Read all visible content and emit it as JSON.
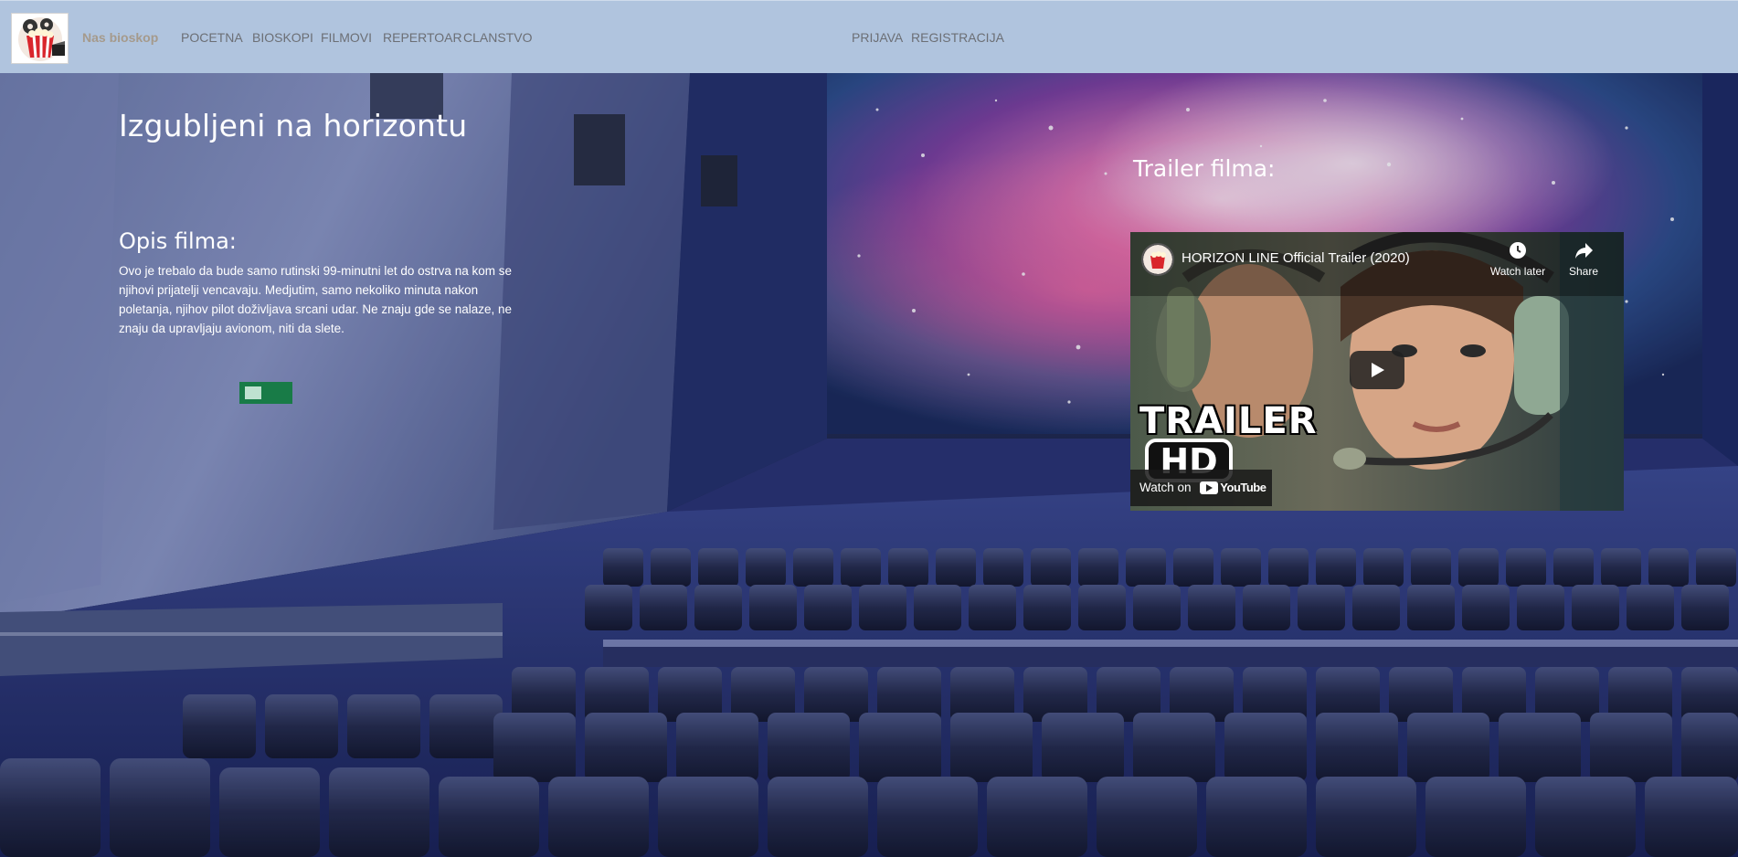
{
  "nav": {
    "brand": "Nas bioskop",
    "items": [
      {
        "label": "POCETNA"
      },
      {
        "label": "BIOSKOPI"
      },
      {
        "label": "FILMOVI"
      },
      {
        "label": "REPERTOAR"
      },
      {
        "label": "CLANSTVO"
      }
    ],
    "auth": [
      {
        "label": "PRIJAVA"
      },
      {
        "label": "REGISTRACIJA"
      }
    ]
  },
  "movie": {
    "title": "Izgubljeni na horizontu",
    "description_heading": "Opis filma:",
    "description": "Ovo je trebalo da bude samo rutinski 99-minutni let do ostrva na kom se njihovi prijatelji vencavaju. Medjutim, samo nekoliko minuta nakon poletanja, njihov pilot doživljava srcani udar. Ne znaju gde se nalaze, ne znaju da upravljaju avionom, niti da slete.",
    "trailer_heading": "Trailer filma:"
  },
  "video": {
    "title": "HORIZON LINE Official Trailer (2020)",
    "watch_later": "Watch later",
    "share": "Share",
    "thumb_text": "TRAILER",
    "thumb_badge": "HD",
    "watch_on": "Watch on",
    "youtube": "YouTube"
  },
  "colors": {
    "navbar": "#b0c4de",
    "nav_text": "#6c6f75",
    "brand_text": "#a59a8c"
  }
}
